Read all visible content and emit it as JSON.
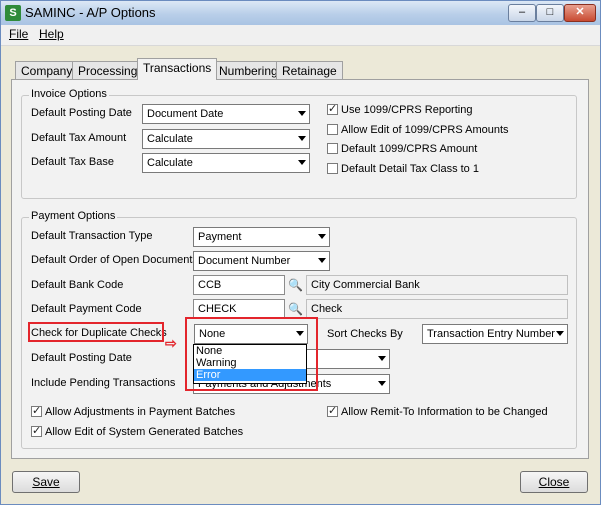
{
  "window": {
    "title": "SAMINC - A/P Options",
    "app_icon": "S",
    "controls": {
      "minimize": "–",
      "maximize": "□",
      "close": "✕"
    }
  },
  "menu": {
    "file": "File",
    "help": "Help"
  },
  "tabs": [
    {
      "label": "Company",
      "active": false
    },
    {
      "label": "Processing",
      "active": false
    },
    {
      "label": "Transactions",
      "active": true
    },
    {
      "label": "Numbering",
      "active": false
    },
    {
      "label": "Retainage",
      "active": false
    }
  ],
  "invoice_options": {
    "title": "Invoice Options",
    "posting_date": {
      "label": "Default Posting Date",
      "value": "Document Date"
    },
    "tax_amount": {
      "label": "Default Tax Amount",
      "value": "Calculate"
    },
    "tax_base": {
      "label": "Default Tax Base",
      "value": "Calculate"
    },
    "checkboxes": [
      {
        "label": "Use 1099/CPRS Reporting",
        "checked": true
      },
      {
        "label": "Allow Edit of 1099/CPRS Amounts",
        "checked": false
      },
      {
        "label": "Default 1099/CPRS Amount",
        "checked": false
      },
      {
        "label": "Default Detail Tax Class to 1",
        "checked": false
      }
    ]
  },
  "payment_options": {
    "title": "Payment Options",
    "transaction_type": {
      "label": "Default Transaction Type",
      "value": "Payment"
    },
    "open_docs_order": {
      "label": "Default Order of Open Documents",
      "value": "Document Number"
    },
    "bank_code": {
      "label": "Default Bank Code",
      "value": "CCB",
      "desc": "City Commercial Bank"
    },
    "payment_code": {
      "label": "Default Payment Code",
      "value": "CHECK",
      "desc": "Check"
    },
    "duplicate_checks": {
      "label": "Check for Duplicate Checks",
      "value": "None",
      "options": [
        "None",
        "Warning",
        "Error"
      ],
      "highlighted": "Error"
    },
    "sort_checks": {
      "label": "Sort Checks By",
      "value": "Transaction Entry Number"
    },
    "posting_date": {
      "label": "Default Posting Date"
    },
    "pending": {
      "label": "Include Pending Transactions",
      "value": "Payments and Adjustments"
    },
    "checkboxes": [
      {
        "label": "Allow Adjustments in Payment Batches",
        "checked": true
      },
      {
        "label": "Allow Edit of System Generated Batches",
        "checked": true
      },
      {
        "label": "Allow Remit-To Information to be Changed",
        "checked": true
      }
    ]
  },
  "buttons": {
    "save": "Save",
    "close": "Close"
  },
  "annotation": {
    "arrow": "⇨",
    "color": "#e3252c"
  },
  "colors": {
    "highlight": "#3399ff",
    "accent_red": "#e3252c"
  },
  "icons": {
    "lookup": "🔍"
  }
}
